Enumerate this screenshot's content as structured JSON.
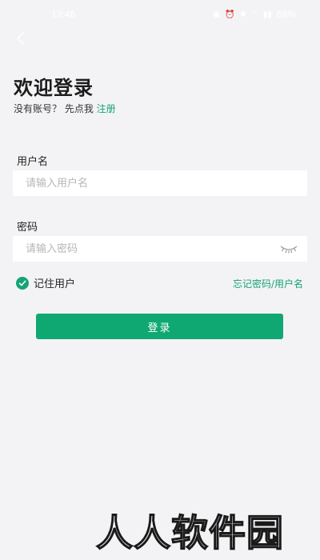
{
  "status_bar": {
    "time": "13:46",
    "battery": "68%"
  },
  "header": {
    "title": "欢迎登录",
    "no_account_text": "没有账号？ 先点我",
    "register_link": "注册"
  },
  "form": {
    "username_label": "用户名",
    "username_placeholder": "请输入用户名",
    "username_value": "",
    "password_label": "密码",
    "password_placeholder": "请输入密码",
    "password_value": "",
    "remember_label": "记住用户",
    "remember_checked": true,
    "forgot_link": "忘记密码/用户名",
    "login_button": "登录"
  },
  "watermark": "人人软件园",
  "colors": {
    "accent": "#17a374",
    "button": "#0fa872",
    "background": "#f3f3f5"
  },
  "icons": [
    "back-arrow-icon",
    "eye-closed-icon",
    "checkmark-icon"
  ]
}
